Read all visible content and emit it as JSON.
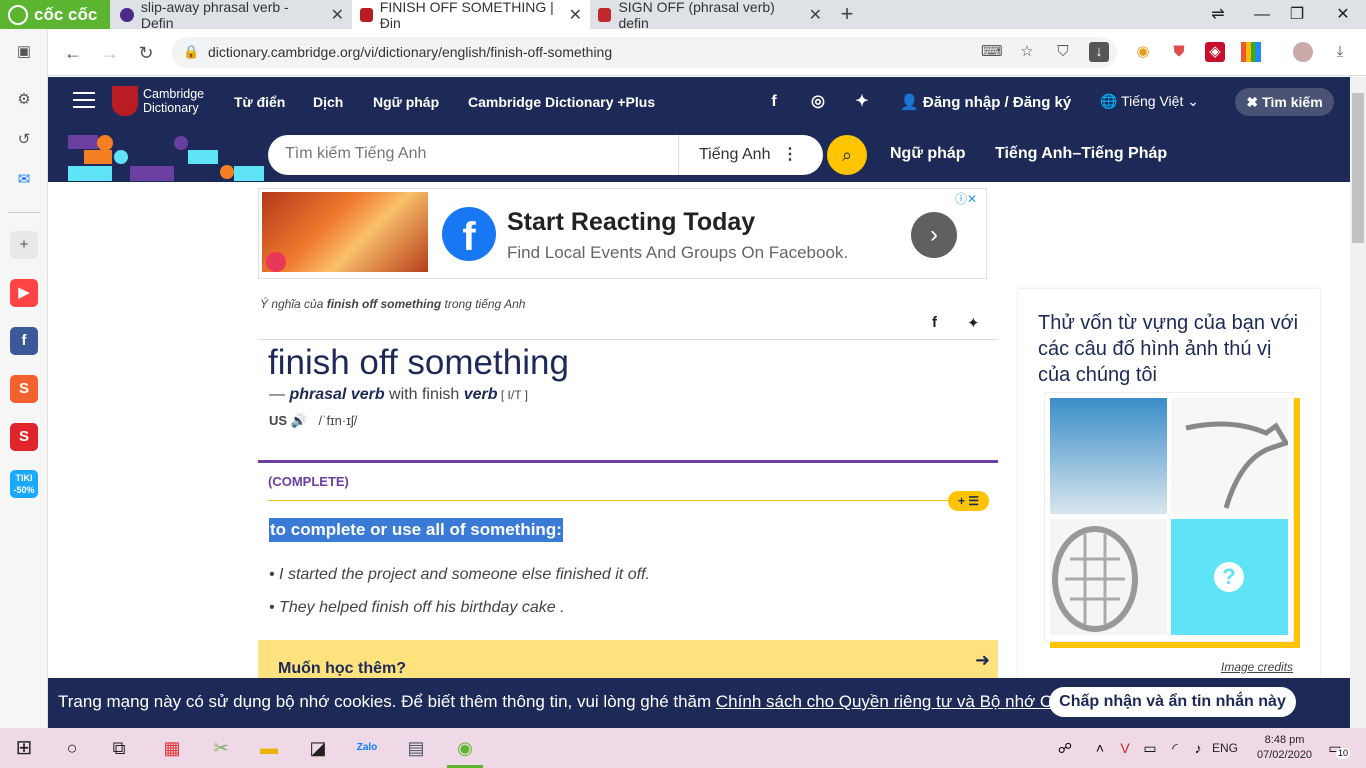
{
  "browser": {
    "brand": "cốc cốc",
    "tabs": [
      {
        "title": "slip-away phrasal verb - Defin",
        "active": false
      },
      {
        "title": "FINISH OFF SOMETHING | Địn",
        "active": true
      },
      {
        "title": "SIGN OFF (phrasal verb) defin",
        "active": false
      }
    ],
    "new_tab": "+",
    "url": "dictionary.cambridge.org/vi/dictionary/english/finish-off-something"
  },
  "header": {
    "logo_line1": "Cambridge",
    "logo_line2": "Dictionary",
    "nav": [
      "Từ điển",
      "Dịch",
      "Ngữ pháp",
      "Cambridge Dictionary +Plus"
    ],
    "login": "Đăng nhập / Đăng ký",
    "language": "Tiếng Việt",
    "search_toggle": "Tìm kiếm",
    "search_placeholder": "Tìm kiếm Tiếng Anh",
    "search_lang": "Tiếng Anh",
    "nav2": [
      "Ngữ pháp",
      "Tiếng Anh–Tiếng Pháp"
    ]
  },
  "ad": {
    "title": "Start Reacting Today",
    "subtitle": "Find Local Events And Groups On Facebook."
  },
  "entry": {
    "meaning_prefix": "Ý nghĩa của ",
    "meaning_word": "finish off something",
    "meaning_suffix": " trong tiếng Anh",
    "headword": "finish off something",
    "pos_dash": "— ",
    "pos": "phrasal verb",
    "with": " with finish ",
    "verb": "verb",
    "grammar": " [ I/T ]",
    "region": "US",
    "ipa": "/ˈfɪn·ɪʃ/",
    "guideword": "(COMPLETE)",
    "definition": "to complete or use all of something:",
    "examples": [
      "I started the project and someone else finished it off.",
      "They helped finish off his birthday cake ."
    ],
    "learn_more": "Muốn học thêm?"
  },
  "quiz": {
    "title": "Thử vốn từ vựng của bạn với các câu đố hình ảnh thú vị của chúng tôi",
    "credits": "Image credits"
  },
  "cookie": {
    "text": "Trang mạng này có sử dụng bộ nhớ cookies. Để biết thêm thông tin, vui lòng ghé thăm ",
    "link": "Chính sách cho Quyền riêng tư và Bộ nhớ Cookies",
    "end": ".",
    "button": "Chấp nhận và ẩn tin nhắn này"
  },
  "taskbar": {
    "lang": "ENG",
    "time": "8:48 pm",
    "date": "07/02/2020",
    "notif_count": "10"
  },
  "sidebar": {
    "tiki_label": "TIKI",
    "tiki_discount": "-50%"
  }
}
